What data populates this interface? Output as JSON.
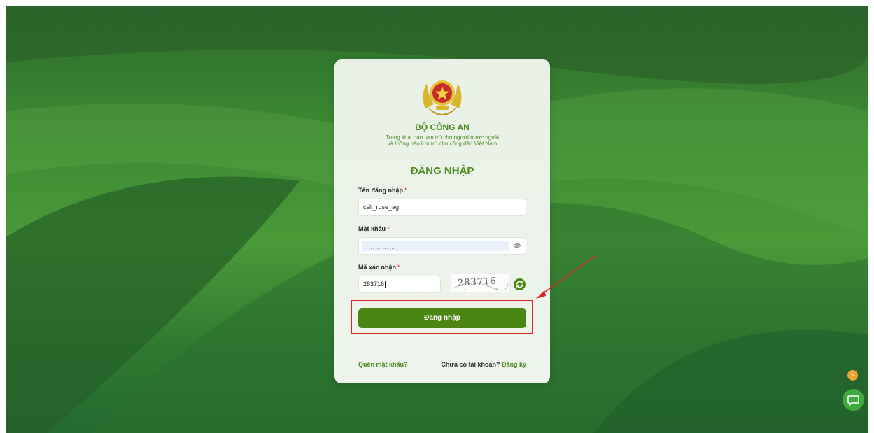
{
  "header": {
    "org_name": "BỘ CÔNG AN",
    "subtitle_line1": "Trang khai báo tạm trú cho người nước ngoài",
    "subtitle_line2": "và thông báo lưu trú cho công dân Việt Nam"
  },
  "form": {
    "title": "ĐĂNG NHẬP",
    "username": {
      "label": "Tên đăng nhập",
      "required_mark": "*",
      "value": "cslt_rose_ag"
    },
    "password": {
      "label": "Mật khẩu",
      "required_mark": "*",
      "value": "············"
    },
    "captcha": {
      "label": "Mã xác nhận",
      "required_mark": "*",
      "value": "283716",
      "image_text": "283716"
    },
    "submit_label": "Đăng nhập",
    "forgot_label": "Quên mật khẩu?",
    "no_account_label": "Chưa có tài khoản?",
    "register_label": "Đăng ký"
  },
  "widgets": {
    "close_icon": "×",
    "chat_icon": "chat-icon"
  },
  "colors": {
    "brand_green": "#4a8a1f",
    "button_green": "#4b8612",
    "annotation_red": "#e02424",
    "widget_orange": "#f0a431",
    "chat_green": "#3fa93f"
  }
}
